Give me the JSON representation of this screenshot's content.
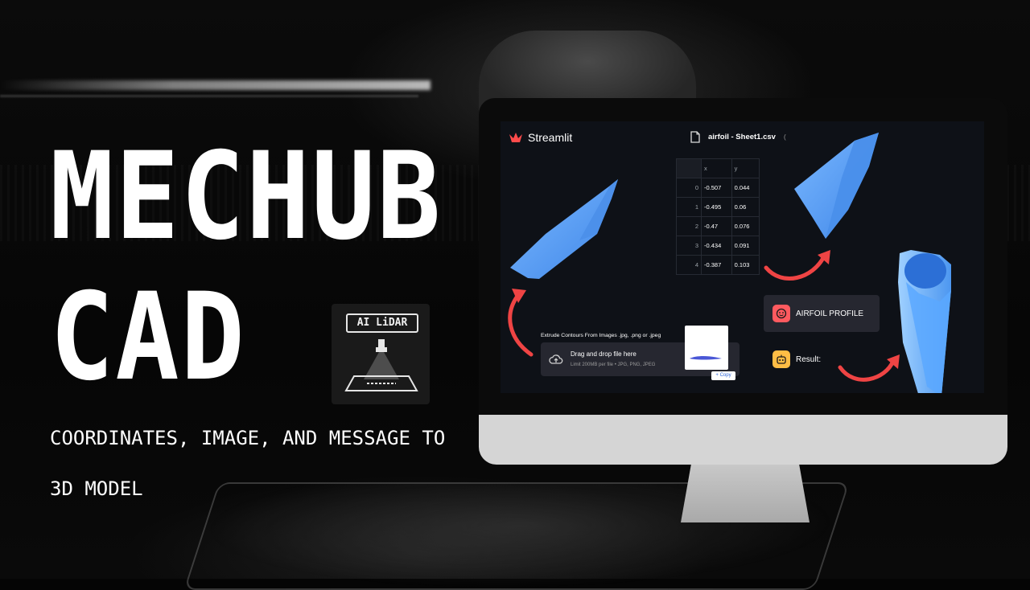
{
  "title": {
    "line1": "MECHUB",
    "line2": "CAD"
  },
  "subtitle": {
    "line1": "COORDINATES, IMAGE, AND MESSAGE TO",
    "line2": "3D MODEL"
  },
  "badge": {
    "label": "AI LiDAR"
  },
  "app": {
    "brand": "Streamlit",
    "brand_color": "#ff4b4b",
    "file_name": "airfoil - Sheet1.csv",
    "file_extra": "(",
    "table": {
      "columns": [
        "",
        "x",
        "y"
      ],
      "rows": [
        [
          "0",
          "-0.507",
          "0.044"
        ],
        [
          "1",
          "-0.495",
          "0.06"
        ],
        [
          "2",
          "-0.47",
          "0.076"
        ],
        [
          "3",
          "-0.434",
          "0.091"
        ],
        [
          "4",
          "-0.387",
          "0.103"
        ]
      ]
    },
    "upload": {
      "label": "Extrude Contours From Images .jpg, .png or .jpeg",
      "drop_title": "Drag and drop file here",
      "limit": "Limit 200MB per file • JPG, PNG, JPEG",
      "copy_label": "+ Copy"
    },
    "profile_button": "AIRFOIL PROFILE",
    "result_label": "Result:"
  },
  "colors": {
    "arrow": "#ef4444",
    "model_blue": "#5aa2f5",
    "screen_bg": "#0e1117"
  }
}
